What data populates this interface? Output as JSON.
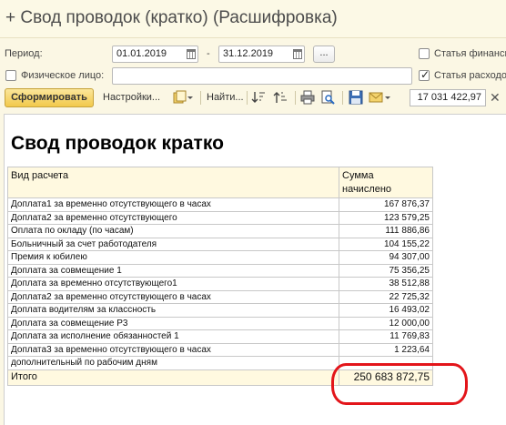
{
  "window": {
    "title": "+ Свод проводок (кратко) (Расшифровка)"
  },
  "filters": {
    "period_label": "Период:",
    "date_from": "01.01.2019",
    "date_separator": "-",
    "date_to": "31.12.2019",
    "period_button": "...",
    "person_label": "Физическое лицо:",
    "person_value": "",
    "person_checked": false,
    "fin_article_label": "Статья финанси",
    "fin_article_checked": false,
    "expense_article_label": "Статья расходо",
    "expense_article_checked": true
  },
  "toolbar": {
    "generate": "Сформировать",
    "settings": "Настройки...",
    "find": "Найти...",
    "sum_value": "17 031 422,97",
    "icons": [
      "report-variants-icon",
      "sort-descending-icon",
      "sort-ascending-icon",
      "print-icon",
      "print-preview-icon",
      "save-icon",
      "email-icon",
      "clear-icon"
    ]
  },
  "report": {
    "title": "Свод проводок кратко",
    "columns": [
      "Вид расчета",
      "Сумма начислено"
    ],
    "rows": [
      {
        "name": "Доплата1 за временно отсутствующего в часах",
        "value": "167 876,37"
      },
      {
        "name": "Доплата2 за временно отсутствующего",
        "value": "123 579,25"
      },
      {
        "name": "Оплата по окладу (по часам)",
        "value": "111 886,86"
      },
      {
        "name": "Больничный за счет работодателя",
        "value": "104 155,22"
      },
      {
        "name": "Премия к юбилею",
        "value": "94 307,00"
      },
      {
        "name": "Доплата за совмещение 1",
        "value": "75 356,25"
      },
      {
        "name": "Доплата за временно отсутствующего1",
        "value": "38 512,88"
      },
      {
        "name": "Доплата2 за временно отсутствующего в часах",
        "value": "22 725,32"
      },
      {
        "name": "Доплата  водителям за классность",
        "value": "16 493,02"
      },
      {
        "name": "Доплата за совмещение Р3",
        "value": "12 000,00"
      },
      {
        "name": "Доплата за исполнение обязанностей 1",
        "value": "11 769,83"
      },
      {
        "name": "Доплата3 за временно отсутствующего в часах",
        "value": "1 223,64"
      },
      {
        "name": "дополнительный по рабочим дням",
        "value": ""
      }
    ],
    "total_label": "Итого",
    "total_value": "250 683 872,75"
  },
  "colors": {
    "background": "#fbf7e4",
    "generate_button": "#f2c94c",
    "highlight_ellipse": "#e3151a",
    "header_row": "#fff9e0"
  }
}
